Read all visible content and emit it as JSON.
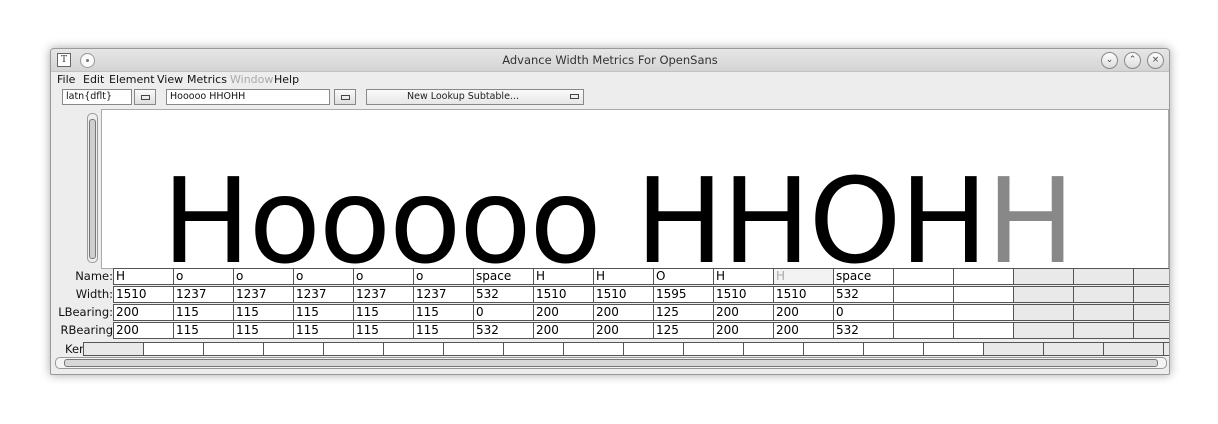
{
  "window": {
    "title": "Advance Width Metrics For OpenSans",
    "app_icon": "T"
  },
  "window_buttons": {
    "minimize": "⌄",
    "maximize": "⌃",
    "close": "×"
  },
  "menu": [
    "File",
    "Edit",
    "Element",
    "View",
    "Metrics",
    "Window",
    "Help"
  ],
  "toolbar": {
    "script_field": "latn{dflt}",
    "text_field": "Hooooo HHOHH",
    "lookup_dropdown": "New Lookup Subtable..."
  },
  "preview": {
    "text_main": "Hooooo HHOH",
    "text_selected": "H"
  },
  "row_labels": {
    "name": "Name:",
    "width": "Width:",
    "lbearing": "LBearing:",
    "rbearing": "RBearing",
    "kern": "Kern:"
  },
  "glyph_table": {
    "names": [
      "H",
      "o",
      "o",
      "o",
      "o",
      "o",
      "space",
      "H",
      "H",
      "O",
      "H",
      "H",
      "space"
    ],
    "widths": [
      "1510",
      "1237",
      "1237",
      "1237",
      "1237",
      "1237",
      "532",
      "1510",
      "1510",
      "1595",
      "1510",
      "1510",
      "532"
    ],
    "lbearings": [
      "200",
      "115",
      "115",
      "115",
      "115",
      "115",
      "0",
      "200",
      "200",
      "125",
      "200",
      "200",
      "0"
    ],
    "rbearings": [
      "200",
      "115",
      "115",
      "115",
      "115",
      "115",
      "532",
      "200",
      "200",
      "125",
      "200",
      "200",
      "532"
    ],
    "selected_index": 11
  }
}
